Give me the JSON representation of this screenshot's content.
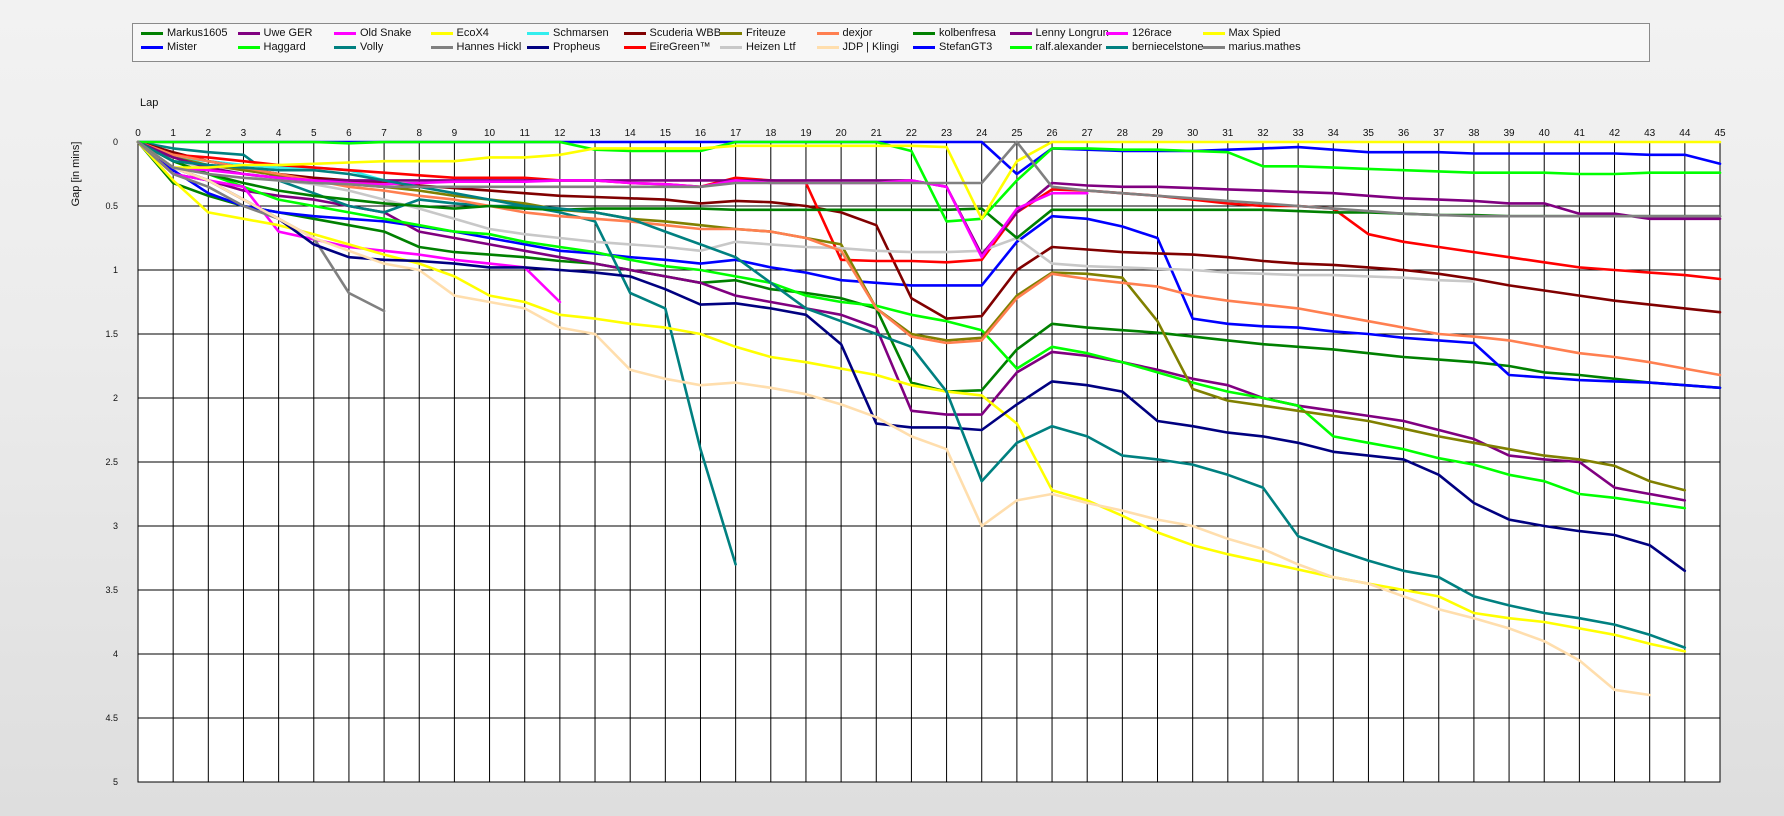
{
  "chart_data": {
    "type": "line",
    "xlabel": "Lap",
    "ylabel": "Gap [in mins]",
    "xlim": [
      0,
      45
    ],
    "ylim": [
      0,
      5
    ],
    "y_inverted": true,
    "x_ticks": [
      0,
      1,
      2,
      3,
      4,
      5,
      6,
      7,
      8,
      9,
      10,
      11,
      12,
      13,
      14,
      15,
      16,
      17,
      18,
      19,
      20,
      21,
      22,
      23,
      24,
      25,
      26,
      27,
      28,
      29,
      30,
      31,
      32,
      33,
      34,
      35,
      36,
      37,
      38,
      39,
      40,
      41,
      42,
      43,
      44,
      45
    ],
    "y_ticks": [
      "0",
      "0.5",
      "1",
      "1.5",
      "2",
      "2.5",
      "3",
      "3.5",
      "4",
      "4.5",
      "5"
    ],
    "grid": true,
    "legend_position": "top",
    "series": [
      {
        "name": "Markus1605",
        "color": "#008000",
        "values": [
          0,
          0.32,
          0.42,
          0.5,
          0.55,
          0.6,
          0.65,
          0.7,
          0.82,
          0.86,
          0.88,
          0.9,
          0.93,
          0.95,
          1.0,
          1.05,
          1.1,
          1.08,
          1.15,
          1.18,
          1.22,
          1.3,
          1.88,
          1.95,
          1.94,
          1.62,
          1.42,
          1.45,
          1.47,
          1.49,
          1.52,
          1.55,
          1.58,
          1.6,
          1.62,
          1.65,
          1.68,
          1.7,
          1.72,
          1.75,
          1.8,
          1.82,
          1.85,
          1.88,
          1.9,
          1.92
        ]
      },
      {
        "name": "Mister",
        "color": "#0000ff",
        "values": [
          0,
          0.22,
          0.4,
          0.5,
          0.55,
          0.58,
          0.6,
          0.62,
          0.66,
          0.7,
          0.75,
          0.8,
          0.85,
          0.87,
          0.9,
          0.92,
          0.95,
          0.92,
          0.98,
          1.02,
          1.08,
          1.1,
          1.12,
          1.12,
          1.12,
          0.78,
          0.58,
          0.6,
          0.66,
          0.75,
          1.38,
          1.42,
          1.44,
          1.45,
          1.48,
          1.5,
          1.53,
          1.55,
          1.57,
          1.82,
          1.84,
          1.86,
          1.87,
          1.88,
          1.9,
          1.92
        ]
      },
      {
        "name": "Uwe GER",
        "color": "#800080",
        "values": [
          0,
          0.25,
          0.3,
          0.38,
          0.42,
          0.45,
          0.5,
          0.55,
          0.7,
          0.75,
          0.8,
          0.85,
          0.9,
          0.95,
          1.0,
          1.05,
          1.1,
          1.2,
          1.25,
          1.3,
          1.35,
          1.45,
          2.1,
          2.13,
          2.13,
          1.8,
          1.64,
          1.67,
          1.72,
          1.78,
          1.85,
          1.9,
          2.0,
          2.06,
          2.1,
          2.14,
          2.18,
          2.25,
          2.32,
          2.45,
          2.48,
          2.5,
          2.7,
          2.75,
          2.8
        ]
      },
      {
        "name": "Haggard",
        "color": "#00ff00",
        "values": [
          0,
          0.15,
          0.25,
          0.35,
          0.45,
          0.5,
          0.55,
          0.6,
          0.65,
          0.7,
          0.72,
          0.78,
          0.82,
          0.86,
          0.92,
          0.97,
          1.0,
          1.05,
          1.1,
          1.2,
          1.25,
          1.28,
          1.35,
          1.4,
          1.47,
          1.77,
          1.6,
          1.65,
          1.72,
          1.8,
          1.88,
          1.95,
          2.0,
          2.06,
          2.3,
          2.35,
          2.4,
          2.47,
          2.52,
          2.6,
          2.65,
          2.75,
          2.78,
          2.82,
          2.86
        ]
      },
      {
        "name": "Old Snake",
        "color": "#ff00ff",
        "values": [
          0,
          0.25,
          0.3,
          0.35,
          0.7,
          0.76,
          0.82,
          0.85,
          0.88,
          0.92,
          0.95,
          0.98,
          1.25
        ]
      },
      {
        "name": "Volly",
        "color": "#008080",
        "values": [
          0,
          0.05,
          0.08,
          0.1,
          0.3,
          0.4,
          0.5,
          0.55,
          0.45,
          0.48,
          0.5,
          0.5,
          0.55,
          0.62,
          1.18,
          1.3,
          2.4,
          3.3
        ]
      },
      {
        "name": "EcoX4",
        "color": "#ffff00",
        "values": [
          0,
          0.3,
          0.55,
          0.6,
          0.65,
          0.72,
          0.8,
          0.88,
          0.95,
          1.05,
          1.2,
          1.25,
          1.35,
          1.38,
          1.42,
          1.45,
          1.5,
          1.6,
          1.68,
          1.72,
          1.77,
          1.82,
          1.9,
          1.95,
          1.98,
          2.2,
          2.72,
          2.8,
          2.92,
          3.05,
          3.15,
          3.22,
          3.28,
          3.34,
          3.4,
          3.45,
          3.5,
          3.55,
          3.68,
          3.72,
          3.75,
          3.8,
          3.85,
          3.92,
          3.98
        ]
      },
      {
        "name": "Hannes Hickl",
        "color": "#808080",
        "values": [
          0,
          0.25,
          0.35,
          0.5,
          0.6,
          0.75,
          1.18,
          1.32
        ]
      },
      {
        "name": "Schmarsen",
        "color": "#33eeee",
        "values": [
          0,
          0.12,
          0.15,
          0.18,
          0.2,
          0.2,
          0.22,
          0.3
        ]
      },
      {
        "name": "Propheus",
        "color": "#000080",
        "values": [
          0,
          0.2,
          0.3,
          0.45,
          0.6,
          0.8,
          0.9,
          0.92,
          0.93,
          0.95,
          0.98,
          0.98,
          1.0,
          1.02,
          1.05,
          1.15,
          1.27,
          1.26,
          1.3,
          1.35,
          1.58,
          2.2,
          2.23,
          2.23,
          2.25,
          2.05,
          1.87,
          1.9,
          1.95,
          2.18,
          2.22,
          2.27,
          2.3,
          2.35,
          2.42,
          2.45,
          2.48,
          2.6,
          2.82,
          2.95,
          3.0,
          3.04,
          3.07,
          3.15,
          3.35
        ]
      },
      {
        "name": "Scuderia WBB",
        "color": "#800000",
        "values": [
          0,
          0.08,
          0.15,
          0.2,
          0.25,
          0.28,
          0.3,
          0.32,
          0.34,
          0.36,
          0.38,
          0.4,
          0.42,
          0.43,
          0.44,
          0.45,
          0.48,
          0.46,
          0.47,
          0.5,
          0.55,
          0.65,
          1.22,
          1.38,
          1.36,
          1.0,
          0.82,
          0.84,
          0.86,
          0.87,
          0.88,
          0.9,
          0.93,
          0.95,
          0.96,
          0.98,
          1.0,
          1.03,
          1.07,
          1.12,
          1.16,
          1.2,
          1.24,
          1.27,
          1.3,
          1.33
        ]
      },
      {
        "name": "EireGreen™",
        "color": "#ff0000",
        "values": [
          0,
          0.1,
          0.12,
          0.15,
          0.18,
          0.2,
          0.22,
          0.24,
          0.26,
          0.28,
          0.28,
          0.28,
          0.3,
          0.3,
          0.32,
          0.33,
          0.35,
          0.28,
          0.3,
          0.32,
          0.92,
          0.93,
          0.93,
          0.94,
          0.92,
          0.55,
          0.37,
          0.38,
          0.4,
          0.42,
          0.45,
          0.48,
          0.5,
          0.5,
          0.52,
          0.72,
          0.78,
          0.82,
          0.86,
          0.9,
          0.94,
          0.98,
          1.0,
          1.02,
          1.04,
          1.07
        ]
      },
      {
        "name": "Friteuze",
        "color": "#808000",
        "values": [
          0,
          0.12,
          0.18,
          0.22,
          0.26,
          0.3,
          0.33,
          0.35,
          0.38,
          0.42,
          0.45,
          0.48,
          0.53,
          0.55,
          0.6,
          0.62,
          0.65,
          0.68,
          0.7,
          0.75,
          0.8,
          1.3,
          1.5,
          1.55,
          1.53,
          1.2,
          1.02,
          1.03,
          1.06,
          1.4,
          1.93,
          2.02,
          2.06,
          2.1,
          2.14,
          2.18,
          2.24,
          2.3,
          2.35,
          2.4,
          2.45,
          2.48,
          2.53,
          2.65,
          2.72
        ]
      },
      {
        "name": "Heizen Ltf",
        "color": "#c8c8c8",
        "values": [
          0,
          0.15,
          0.2,
          0.25,
          0.3,
          0.33,
          0.38,
          0.45,
          0.52,
          0.6,
          0.68,
          0.72,
          0.75,
          0.78,
          0.8,
          0.82,
          0.85,
          0.78,
          0.8,
          0.82,
          0.83,
          0.85,
          0.86,
          0.86,
          0.85,
          0.75,
          0.95,
          0.97,
          0.98,
          0.99,
          1.0,
          1.02,
          1.03,
          1.04,
          1.04,
          1.05,
          1.06,
          1.08,
          1.09
        ]
      },
      {
        "name": "dexjor",
        "color": "#ff7f50",
        "values": [
          0,
          0.1,
          0.15,
          0.2,
          0.25,
          0.3,
          0.35,
          0.38,
          0.42,
          0.45,
          0.5,
          0.55,
          0.58,
          0.6,
          0.62,
          0.65,
          0.68,
          0.68,
          0.7,
          0.75,
          0.85,
          1.3,
          1.52,
          1.57,
          1.55,
          1.22,
          1.03,
          1.07,
          1.1,
          1.13,
          1.2,
          1.24,
          1.27,
          1.3,
          1.35,
          1.4,
          1.45,
          1.5,
          1.52,
          1.55,
          1.6,
          1.65,
          1.68,
          1.72,
          1.77,
          1.82
        ]
      },
      {
        "name": "JDP | Klingi",
        "color": "#ffdead",
        "values": [
          0,
          0.2,
          0.3,
          0.45,
          0.6,
          0.75,
          0.85,
          0.95,
          1.0,
          1.2,
          1.25,
          1.3,
          1.45,
          1.5,
          1.78,
          1.85,
          1.9,
          1.88,
          1.92,
          1.97,
          2.05,
          2.15,
          2.3,
          2.4,
          3.0,
          2.8,
          2.75,
          2.82,
          2.88,
          2.95,
          3.0,
          3.1,
          3.18,
          3.3,
          3.4,
          3.45,
          3.55,
          3.65,
          3.72,
          3.8,
          3.9,
          4.05,
          4.28,
          4.32
        ]
      },
      {
        "name": "kolbenfresa",
        "color": "#008000",
        "values": [
          0,
          0.15,
          0.25,
          0.32,
          0.38,
          0.42,
          0.45,
          0.48,
          0.5,
          0.52,
          0.5,
          0.52,
          0.53,
          0.52,
          0.52,
          0.52,
          0.52,
          0.53,
          0.53,
          0.53,
          0.53,
          0.53,
          0.53,
          0.53,
          0.52,
          0.75,
          0.53,
          0.53,
          0.53,
          0.53,
          0.53,
          0.53,
          0.53,
          0.54,
          0.55,
          0.55,
          0.56,
          0.57,
          0.57,
          0.58,
          0.58,
          0.58,
          0.58,
          0.58,
          0.58,
          0.58
        ]
      },
      {
        "name": "StefanGT3",
        "color": "#0000ff",
        "values": [
          0,
          0,
          0,
          0,
          0,
          0,
          0,
          0,
          0,
          0,
          0,
          0,
          0,
          0,
          0,
          0,
          0,
          0,
          0,
          0,
          0,
          0,
          0,
          0,
          0,
          0.25,
          0.05,
          0.06,
          0.07,
          0.07,
          0.07,
          0.06,
          0.05,
          0.04,
          0.06,
          0.08,
          0.08,
          0.08,
          0.09,
          0.09,
          0.09,
          0.09,
          0.09,
          0.1,
          0.1,
          0.17
        ]
      },
      {
        "name": "Lenny Longrun",
        "color": "#800080",
        "values": [
          0,
          0.12,
          0.2,
          0.25,
          0.28,
          0.3,
          0.3,
          0.3,
          0.3,
          0.3,
          0.3,
          0.3,
          0.3,
          0.3,
          0.3,
          0.3,
          0.3,
          0.3,
          0.3,
          0.3,
          0.3,
          0.3,
          0.3,
          0.35,
          0.88,
          0.55,
          0.32,
          0.34,
          0.35,
          0.35,
          0.36,
          0.37,
          0.38,
          0.39,
          0.4,
          0.42,
          0.44,
          0.45,
          0.46,
          0.48,
          0.48,
          0.56,
          0.56,
          0.6,
          0.6,
          0.6
        ]
      },
      {
        "name": "ralf.alexander",
        "color": "#00ff00",
        "values": [
          0,
          0,
          0,
          0,
          0,
          0,
          0.01,
          0,
          0,
          0,
          0,
          0,
          0,
          0.06,
          0.07,
          0.07,
          0.07,
          0.0,
          0.0,
          0.0,
          0.0,
          0.0,
          0.07,
          0.62,
          0.6,
          0.3,
          0.05,
          0.05,
          0.06,
          0.06,
          0.07,
          0.08,
          0.19,
          0.19,
          0.2,
          0.21,
          0.22,
          0.23,
          0.24,
          0.24,
          0.24,
          0.25,
          0.25,
          0.24,
          0.24,
          0.24
        ]
      },
      {
        "name": "126race",
        "color": "#ff00ff",
        "values": [
          0,
          0.2,
          0.22,
          0.25,
          0.28,
          0.3,
          0.32,
          0.33,
          0.32,
          0.31,
          0.31,
          0.31,
          0.3,
          0.3,
          0.32,
          0.33,
          0.35,
          0.3,
          0.32,
          0.32,
          0.32,
          0.32,
          0.3,
          0.35,
          0.9,
          0.52,
          0.4,
          0.4
        ]
      },
      {
        "name": "berniecelstone",
        "color": "#008080",
        "values": [
          0,
          0.15,
          0.18,
          0.2,
          0.22,
          0.22,
          0.25,
          0.3,
          0.35,
          0.4,
          0.45,
          0.5,
          0.52,
          0.55,
          0.6,
          0.7,
          0.8,
          0.9,
          1.1,
          1.3,
          1.4,
          1.5,
          1.6,
          1.95,
          2.65,
          2.35,
          2.22,
          2.3,
          2.45,
          2.48,
          2.52,
          2.6,
          2.7,
          3.08,
          3.18,
          3.27,
          3.35,
          3.4,
          3.55,
          3.62,
          3.68,
          3.72,
          3.77,
          3.85,
          3.95
        ]
      },
      {
        "name": "Max Spied",
        "color": "#ffff00",
        "values": [
          0,
          0.2,
          0.2,
          0.18,
          0.18,
          0.17,
          0.16,
          0.15,
          0.15,
          0.15,
          0.12,
          0.12,
          0.1,
          0.05,
          0.05,
          0.05,
          0.05,
          0.03,
          0.03,
          0.03,
          0.03,
          0.03,
          0.03,
          0.04,
          0.6,
          0.15,
          0,
          0,
          0,
          0,
          0,
          0,
          0,
          0,
          0,
          0,
          0,
          0,
          0,
          0,
          0,
          0,
          0,
          0,
          0,
          0
        ]
      },
      {
        "name": "marius.mathes",
        "color": "#808080",
        "values": [
          0,
          0.2,
          0.25,
          0.28,
          0.3,
          0.32,
          0.33,
          0.35,
          0.35,
          0.35,
          0.35,
          0.35,
          0.35,
          0.35,
          0.35,
          0.35,
          0.35,
          0.32,
          0.32,
          0.32,
          0.32,
          0.32,
          0.32,
          0.32,
          0.32,
          0,
          0.35,
          0.38,
          0.4,
          0.42,
          0.44,
          0.46,
          0.48,
          0.5,
          0.52,
          0.54,
          0.56,
          0.57,
          0.58,
          0.58,
          0.58,
          0.58,
          0.58,
          0.58,
          0.58,
          0.58
        ]
      }
    ]
  }
}
